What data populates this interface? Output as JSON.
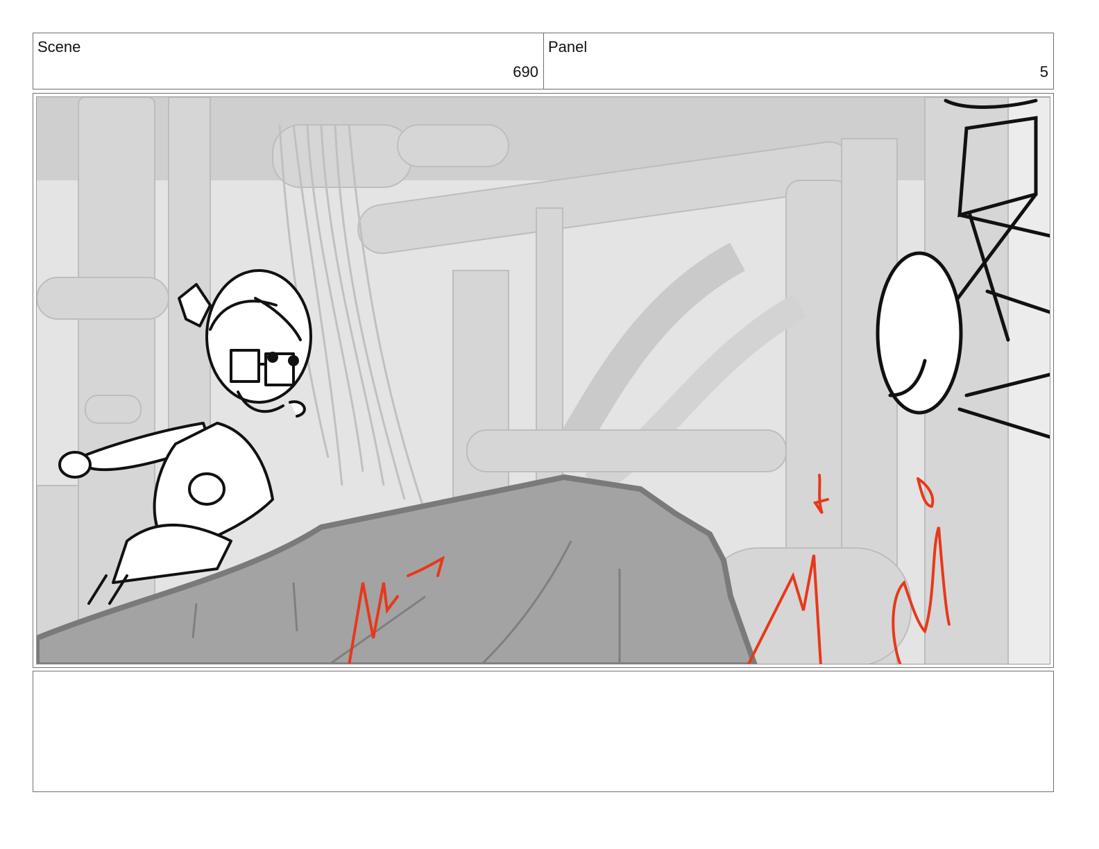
{
  "header": {
    "scene_label": "Scene",
    "scene_value": "690",
    "panel_label": "Panel",
    "panel_value": "5"
  },
  "frame": {
    "content": "storyboard-drawing"
  },
  "notes": {
    "text": ""
  },
  "colors": {
    "border": "#6f6f6f",
    "background_render": "#e3e3e3",
    "rock_fill": "#a3a3a3",
    "ink": "#111111",
    "effect_lines": "#e8381a"
  }
}
